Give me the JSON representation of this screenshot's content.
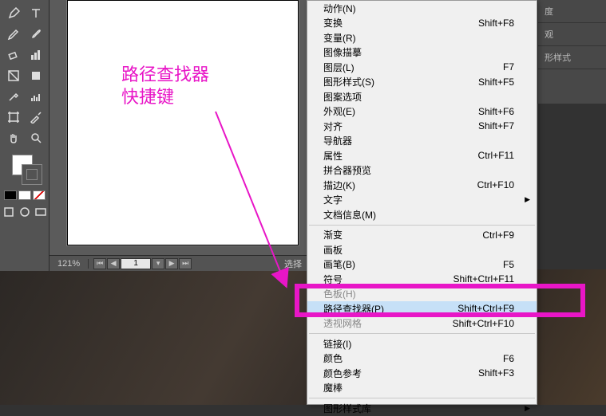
{
  "annotation": {
    "line1": "路径查找器",
    "line2": "快捷键"
  },
  "status": {
    "zoom": "121%",
    "page": "1",
    "sel": "选择"
  },
  "right_panels": [
    "度",
    "观",
    "形样式"
  ],
  "menu": {
    "items": [
      {
        "label": "动作(N)",
        "shortcut": ""
      },
      {
        "label": "变换",
        "shortcut": "Shift+F8"
      },
      {
        "label": "变量(R)",
        "shortcut": ""
      },
      {
        "label": "图像描摹",
        "shortcut": ""
      },
      {
        "label": "图层(L)",
        "shortcut": "F7"
      },
      {
        "label": "图形样式(S)",
        "shortcut": "Shift+F5"
      },
      {
        "label": "图案选项",
        "shortcut": ""
      },
      {
        "label": "外观(E)",
        "shortcut": "Shift+F6"
      },
      {
        "label": "对齐",
        "shortcut": "Shift+F7"
      },
      {
        "label": "导航器",
        "shortcut": ""
      },
      {
        "label": "属性",
        "shortcut": "Ctrl+F11"
      },
      {
        "label": "拼合器预览",
        "shortcut": ""
      },
      {
        "label": "描边(K)",
        "shortcut": "Ctrl+F10"
      },
      {
        "label": "文字",
        "shortcut": "",
        "submenu": true
      },
      {
        "label": "文档信息(M)",
        "shortcut": ""
      },
      {
        "sep": true
      },
      {
        "label": "渐变",
        "shortcut": "Ctrl+F9"
      },
      {
        "label": "画板",
        "shortcut": ""
      },
      {
        "label": "画笔(B)",
        "shortcut": "F5"
      },
      {
        "label": "符号",
        "shortcut": "Shift+Ctrl+F11"
      },
      {
        "label": "色板(H)",
        "shortcut": "",
        "disabled": true
      },
      {
        "label": "路径查找器(P)",
        "shortcut": "Shift+Ctrl+F9",
        "highlight": true
      },
      {
        "label": "透视网格",
        "shortcut": "Shift+Ctrl+F10",
        "disabled": true
      },
      {
        "sep": true
      },
      {
        "label": "链接(I)",
        "shortcut": ""
      },
      {
        "label": "颜色",
        "shortcut": "F6"
      },
      {
        "label": "颜色参考",
        "shortcut": "Shift+F3"
      },
      {
        "label": "魔棒",
        "shortcut": ""
      },
      {
        "sep": true
      },
      {
        "label": "图形样式库",
        "shortcut": "",
        "submenu": true
      }
    ]
  }
}
